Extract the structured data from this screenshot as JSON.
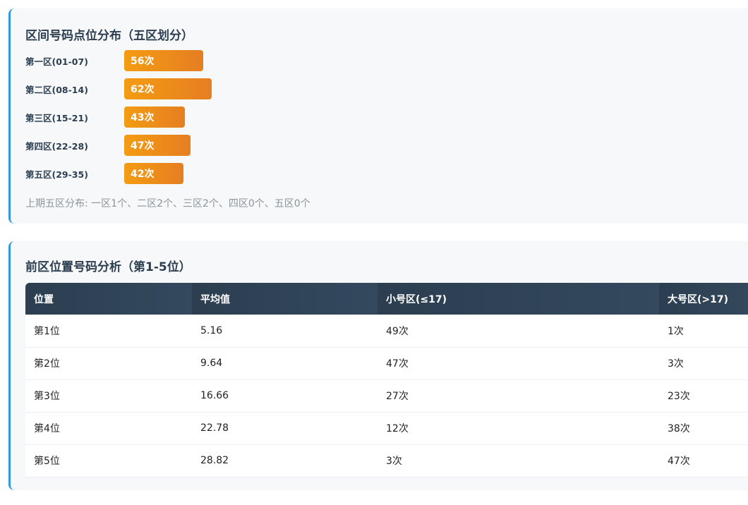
{
  "zones": {
    "title": "区间号码点位分布（五区划分）",
    "items": [
      {
        "label": "第一区(01-07)",
        "count": 56,
        "text": "56次"
      },
      {
        "label": "第二区(08-14)",
        "count": 62,
        "text": "62次"
      },
      {
        "label": "第三区(15-21)",
        "count": 43,
        "text": "43次"
      },
      {
        "label": "第四区(22-28)",
        "count": 47,
        "text": "47次"
      },
      {
        "label": "第五区(29-35)",
        "count": 42,
        "text": "42次"
      }
    ],
    "note": "上期五区分布: 一区1个、二区2个、三区2个、四区0个、五区0个",
    "bar_color_start": "#f39c12",
    "bar_color_end": "#e67e22"
  },
  "positions": {
    "title": "前区位置号码分析（第1-5位）",
    "headers": [
      "位置",
      "平均值",
      "小号区(≤17)",
      "大号区(>17)"
    ],
    "rows": [
      [
        "第1位",
        "5.16",
        "49次",
        "1次"
      ],
      [
        "第2位",
        "9.64",
        "47次",
        "3次"
      ],
      [
        "第3位",
        "16.66",
        "27次",
        "23次"
      ],
      [
        "第4位",
        "22.78",
        "12次",
        "38次"
      ],
      [
        "第5位",
        "28.82",
        "3次",
        "47次"
      ]
    ]
  }
}
